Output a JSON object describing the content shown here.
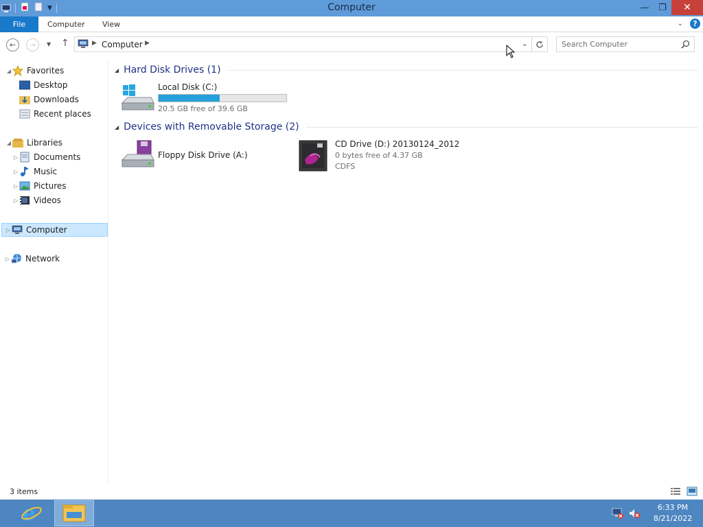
{
  "window": {
    "title": "Computer",
    "controls": {
      "minimize": "—",
      "restore": "❐",
      "close": "✕"
    }
  },
  "ribbon": {
    "tabs": [
      "File",
      "Computer",
      "View"
    ]
  },
  "address": {
    "path": [
      "Computer"
    ],
    "search_placeholder": "Search Computer"
  },
  "navpane": {
    "favorites": {
      "label": "Favorites",
      "items": [
        "Desktop",
        "Downloads",
        "Recent places"
      ]
    },
    "libraries": {
      "label": "Libraries",
      "items": [
        "Documents",
        "Music",
        "Pictures",
        "Videos"
      ]
    },
    "computer": "Computer",
    "network": "Network"
  },
  "content": {
    "hard_disk_group": "Hard Disk Drives (1)",
    "removable_group": "Devices with Removable Storage (2)",
    "drives": {
      "c": {
        "name": "Local Disk (C:)",
        "free_text": "20.5 GB free of 39.6 GB",
        "used_fraction": 0.48
      },
      "a": {
        "name": "Floppy Disk Drive (A:)"
      },
      "d": {
        "name": "CD Drive (D:) 20130124_2012",
        "free_text": "0 bytes free of 4.37 GB",
        "fs": "CDFS"
      }
    }
  },
  "status": {
    "item_count": "3 items"
  },
  "taskbar": {
    "time": "6:33 PM",
    "date": "8/21/2022"
  },
  "colors": {
    "accent": "#1979ca",
    "titlebar": "#5e9bd8",
    "taskbar": "#4d86c0",
    "capacity": "#26a0da",
    "close": "#c7413a"
  }
}
